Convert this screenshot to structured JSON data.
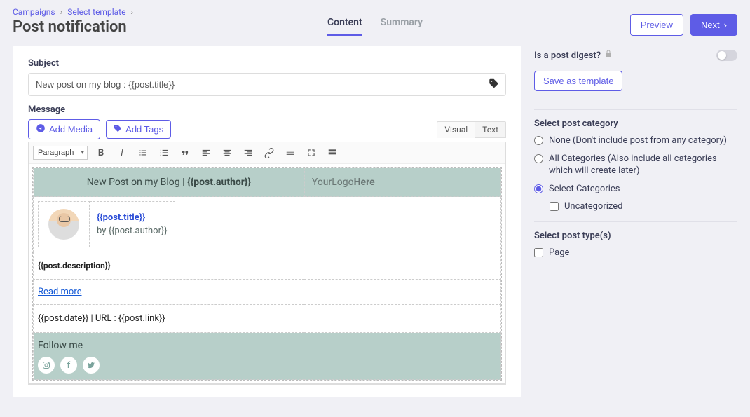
{
  "breadcrumb": {
    "item1": "Campaigns",
    "item2": "Select template"
  },
  "page_title": "Post notification",
  "tabs": {
    "content": "Content",
    "summary": "Summary"
  },
  "buttons": {
    "preview": "Preview",
    "next": "Next",
    "add_media": "Add Media",
    "add_tags": "Add Tags",
    "save_template": "Save as template"
  },
  "subject": {
    "label": "Subject",
    "value": "New post on my blog : {{post.title}}"
  },
  "message": {
    "label": "Message"
  },
  "editor_tabs": {
    "visual": "Visual",
    "text": "Text"
  },
  "format_select": "Paragraph",
  "email": {
    "header_left_prefix": "New Post on my Blog | ",
    "header_left_var": "{{post.author}}",
    "logo_text_a": "YourLogo",
    "logo_text_b": "Here",
    "post_title": "{{post.title}}",
    "post_by_prefix": "by ",
    "post_by_var": "{{post.author}}",
    "description": "{{post.description}}",
    "read_more": "Read more",
    "meta": "{{post.date}} | URL : {{post.link}}",
    "follow": "Follow me"
  },
  "sidebar": {
    "digest_label": "Is a post digest?",
    "category_label": "Select post category",
    "cat_none": "None (Don't include post from any category)",
    "cat_all": "All Categories (Also include all categories which will create later)",
    "cat_select": "Select Categories",
    "cat_uncat": "Uncategorized",
    "type_label": "Select post type(s)",
    "type_page": "Page"
  }
}
